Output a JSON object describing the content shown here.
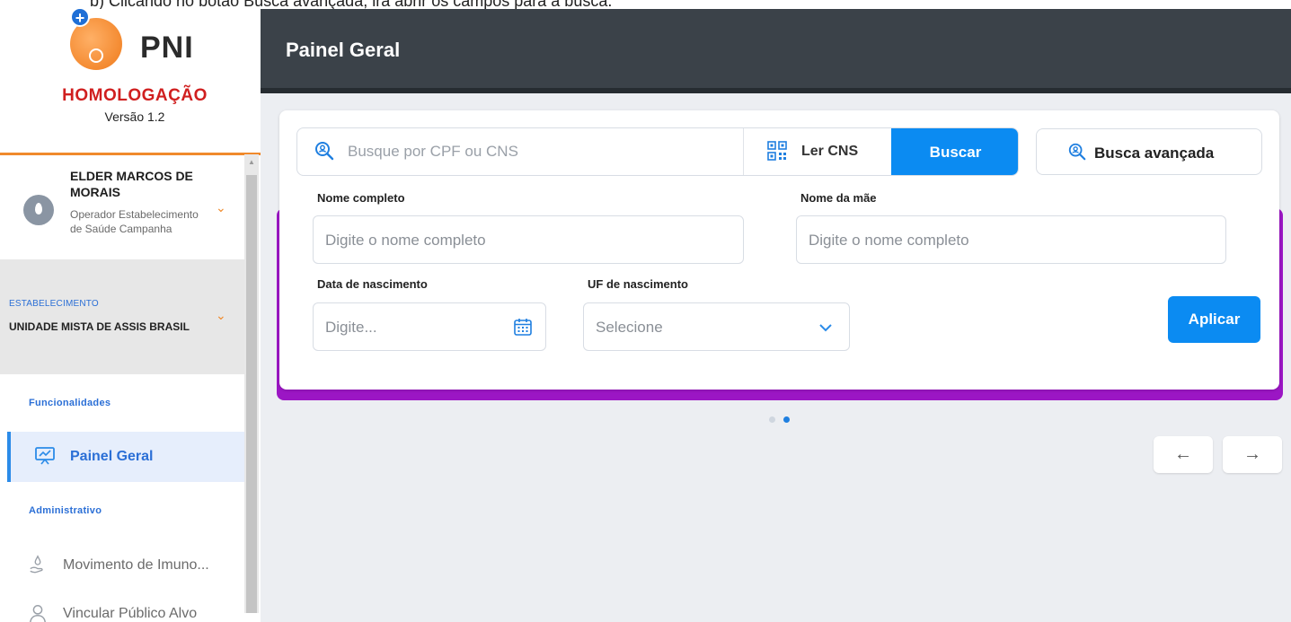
{
  "doc_caption": "b)   Clicando no botão Busca avançada, irá abrir os campos para a busca.",
  "brand": {
    "name": "PNI",
    "env": "HOMOLOGAÇÃO",
    "version": "Versão 1.2"
  },
  "user": {
    "name": "ELDER MARCOS DE MORAIS",
    "role": "Operador Estabelecimento de Saúde Campanha"
  },
  "establishment": {
    "label": "ESTABELECIMENTO",
    "value": "UNIDADE MISTA DE ASSIS BRASIL"
  },
  "sidebar": {
    "section_functions": "Funcionalidades",
    "section_admin": "Administrativo",
    "items": [
      {
        "label": "Painel Geral",
        "icon": "presentation-chart-icon",
        "active": true
      },
      {
        "label": "Movimento de Imuno...",
        "icon": "hand-drop-icon",
        "active": false
      },
      {
        "label": "Vincular Público Alvo",
        "icon": "user-icon",
        "active": false
      }
    ]
  },
  "header": {
    "title": "Painel Geral"
  },
  "search": {
    "placeholder": "Busque por CPF ou CNS",
    "read_cns_label": "Ler CNS",
    "search_button": "Buscar",
    "advanced_button": "Busca avançada"
  },
  "advanced_form": {
    "full_name_label": "Nome completo",
    "full_name_placeholder": "Digite o nome completo",
    "mother_name_label": "Nome da mãe",
    "mother_name_placeholder": "Digite o nome completo",
    "birth_date_label": "Data de nascimento",
    "birth_date_placeholder": "Digite...",
    "birth_uf_label": "UF de nascimento",
    "birth_uf_placeholder": "Selecione",
    "apply_button": "Aplicar"
  },
  "carousel": {
    "arrow_prev": "←",
    "arrow_next": "→",
    "active_page": 2,
    "pages": 2
  },
  "colors": {
    "primary": "#0b8bf2",
    "accent": "#f08a2c",
    "topbar": "#3b4249",
    "purple": "#9b16c4",
    "env": "#d01f1f"
  }
}
